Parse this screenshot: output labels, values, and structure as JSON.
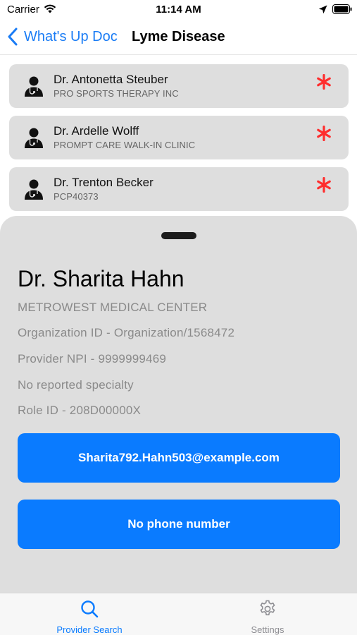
{
  "status_bar": {
    "carrier": "Carrier",
    "time": "11:14 AM"
  },
  "nav": {
    "back_label": "What's Up Doc",
    "title": "Lyme Disease"
  },
  "providers": [
    {
      "name": "Dr. Antonetta Steuber",
      "org": "PRO SPORTS THERAPY INC"
    },
    {
      "name": "Dr. Ardelle Wolff",
      "org": "PROMPT CARE WALK-IN CLINIC"
    },
    {
      "name": "Dr. Trenton Becker",
      "org": "PCP40373"
    }
  ],
  "detail": {
    "name": "Dr. Sharita Hahn",
    "organization": "METROWEST MEDICAL CENTER",
    "organization_id": "Organization ID - Organization/1568472",
    "npi": "Provider NPI - 9999999469",
    "specialty": "No reported specialty",
    "role_id": "Role ID - 208D00000X",
    "email_button": "Sharita792.Hahn503@example.com",
    "phone_button": "No phone number"
  },
  "tabs": [
    {
      "label": "Provider Search",
      "icon": "search-icon",
      "active": true
    },
    {
      "label": "Settings",
      "icon": "gear-icon",
      "active": false
    }
  ],
  "colors": {
    "accent": "#0a7bff",
    "link": "#1a7cf5",
    "asterisk": "#ff2d2d",
    "card_bg": "#dedede",
    "inactive_tab": "#8e8e93"
  }
}
